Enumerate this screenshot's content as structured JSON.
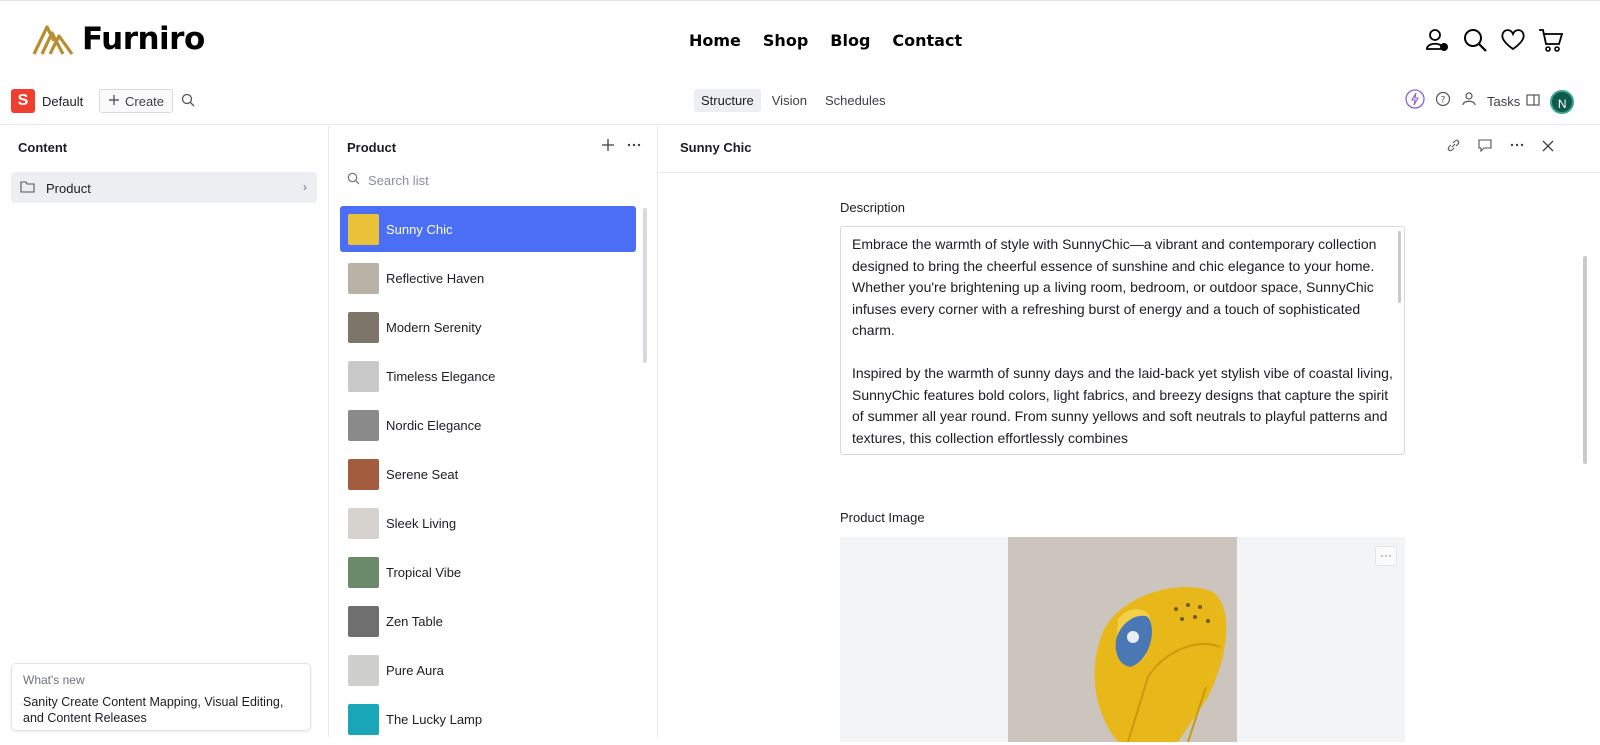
{
  "site": {
    "logo_text": "Furniro",
    "brand_color": "#b88e2f",
    "nav": [
      {
        "label": "Home"
      },
      {
        "label": "Shop"
      },
      {
        "label": "Blog"
      },
      {
        "label": "Contact"
      }
    ],
    "icons": [
      "user-alert-icon",
      "search-icon",
      "heart-icon",
      "cart-icon"
    ]
  },
  "studio": {
    "workspace_logo": "S",
    "workspace_name": "Default",
    "create_label": "Create",
    "tools": [
      {
        "label": "Structure",
        "active": true
      },
      {
        "label": "Vision",
        "active": false
      },
      {
        "label": "Schedules",
        "active": false
      }
    ],
    "tasks_label": "Tasks",
    "avatar_initial": "N"
  },
  "content_pane": {
    "title": "Content",
    "folder_label": "Product",
    "whats_new_title": "What's new",
    "whats_new_text": "Sanity Create Content Mapping, Visual Editing, and Content Releases"
  },
  "product_pane": {
    "title": "Product",
    "search_placeholder": "Search list",
    "items": [
      {
        "label": "Sunny Chic",
        "selected": true,
        "thumb": "#e9c23a"
      },
      {
        "label": "Reflective Haven",
        "selected": false,
        "thumb": "#b9b2a6"
      },
      {
        "label": "Modern Serenity",
        "selected": false,
        "thumb": "#7d7568"
      },
      {
        "label": "Timeless Elegance",
        "selected": false,
        "thumb": "#c9c9c9"
      },
      {
        "label": "Nordic Elegance",
        "selected": false,
        "thumb": "#8a8a8a"
      },
      {
        "label": "Serene Seat",
        "selected": false,
        "thumb": "#a45c3f"
      },
      {
        "label": "Sleek Living",
        "selected": false,
        "thumb": "#d6d3cf"
      },
      {
        "label": "Tropical Vibe",
        "selected": false,
        "thumb": "#6a8a6a"
      },
      {
        "label": "Zen Table",
        "selected": false,
        "thumb": "#6f6f6f"
      },
      {
        "label": "Pure Aura",
        "selected": false,
        "thumb": "#cfcfcd"
      },
      {
        "label": "The Lucky Lamp",
        "selected": false,
        "thumb": "#19a6b8"
      }
    ]
  },
  "document": {
    "title": "Sunny Chic",
    "description_label": "Description",
    "description_p1": "Embrace the warmth of style with SunnyChic—a vibrant and contemporary collection designed to bring the cheerful essence of sunshine and chic elegance to your home. Whether you're brightening up a living room, bedroom, or outdoor space, SunnyChic infuses every corner with a refreshing burst of energy and a touch of sophisticated charm.",
    "description_p2": "Inspired by the warmth of sunny days and the laid-back yet stylish vibe of coastal living, SunnyChic features bold colors, light fabrics, and breezy designs that capture the spirit of summer all year round. From sunny yellows and soft neutrals to playful patterns and textures, this collection effortlessly combines",
    "image_label": "Product Image"
  }
}
